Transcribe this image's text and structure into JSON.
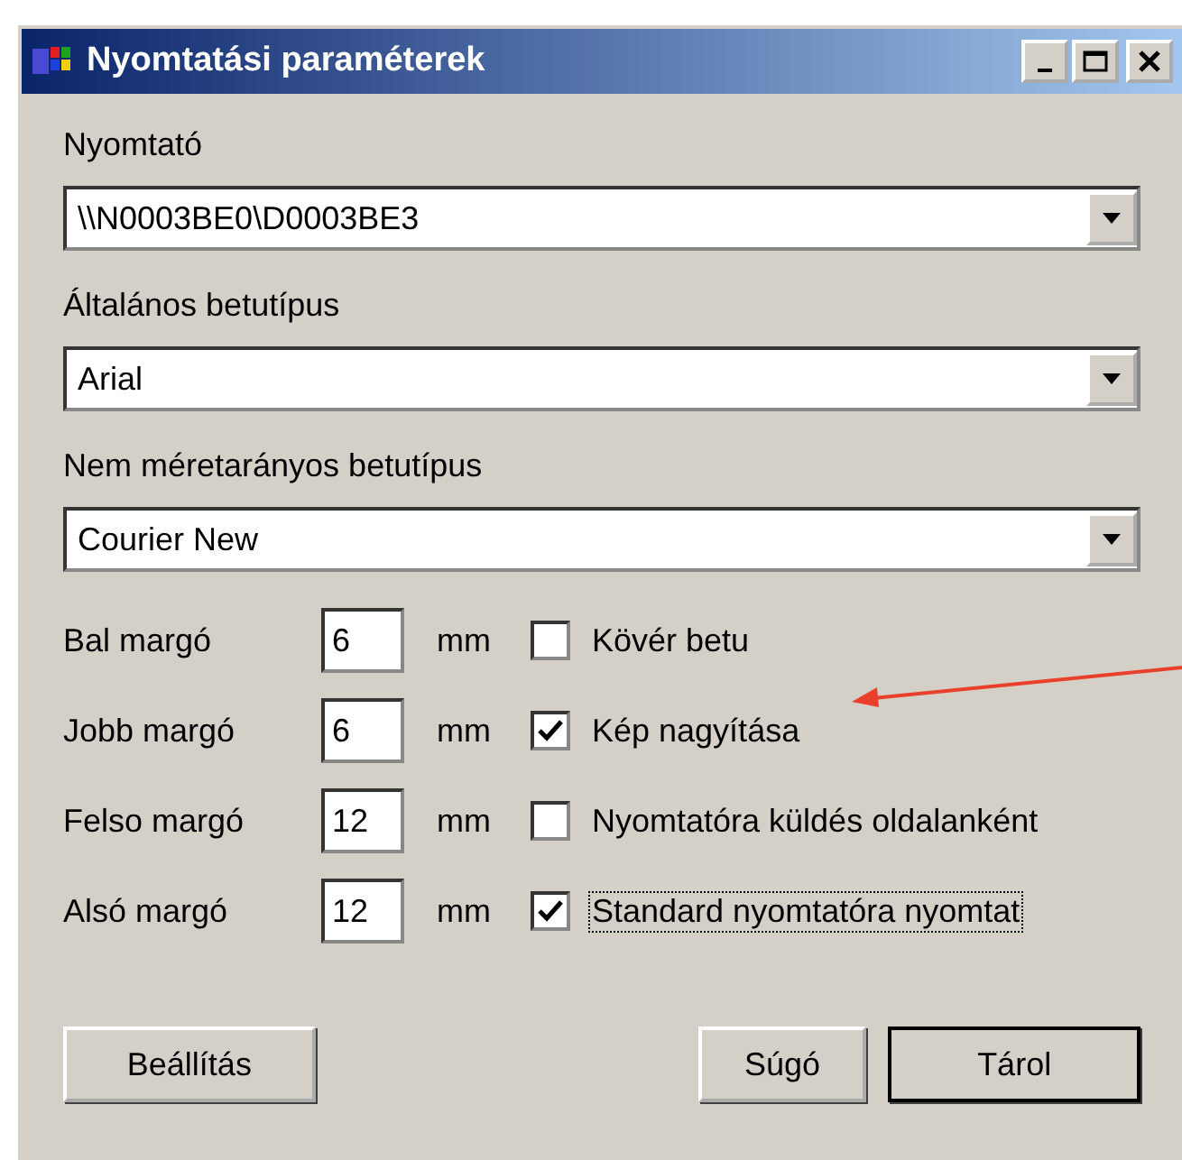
{
  "window": {
    "title": "Nyomtatási paraméterek"
  },
  "fonts": [
    {
      "label": "Nyomtató",
      "value": "\\\\N0003BE0\\D0003BE3"
    },
    {
      "label": "Általános betutípus",
      "value": "Arial"
    },
    {
      "label": "Nem méretarányos betutípus",
      "value": "Courier New"
    }
  ],
  "margins": [
    {
      "label": "Bal margó",
      "value": "6",
      "unit": "mm",
      "option": {
        "label": "Kövér betu",
        "checked": false,
        "focused": false
      }
    },
    {
      "label": "Jobb margó",
      "value": "6",
      "unit": "mm",
      "option": {
        "label": "Kép nagyítása",
        "checked": true,
        "focused": false
      }
    },
    {
      "label": "Felso margó",
      "value": "12",
      "unit": "mm",
      "option": {
        "label": "Nyomtatóra küldés oldalanként",
        "checked": false,
        "focused": false
      }
    },
    {
      "label": "Alsó margó",
      "value": "12",
      "unit": "mm",
      "option": {
        "label": "Standard nyomtatóra nyomtat",
        "checked": true,
        "focused": true
      }
    }
  ],
  "buttons": [
    {
      "label": "Beállítás",
      "default": false
    },
    {
      "label": "Súgó",
      "default": false
    },
    {
      "label": "Tárol",
      "default": true
    }
  ],
  "annotation": {
    "kind": "arrow"
  }
}
